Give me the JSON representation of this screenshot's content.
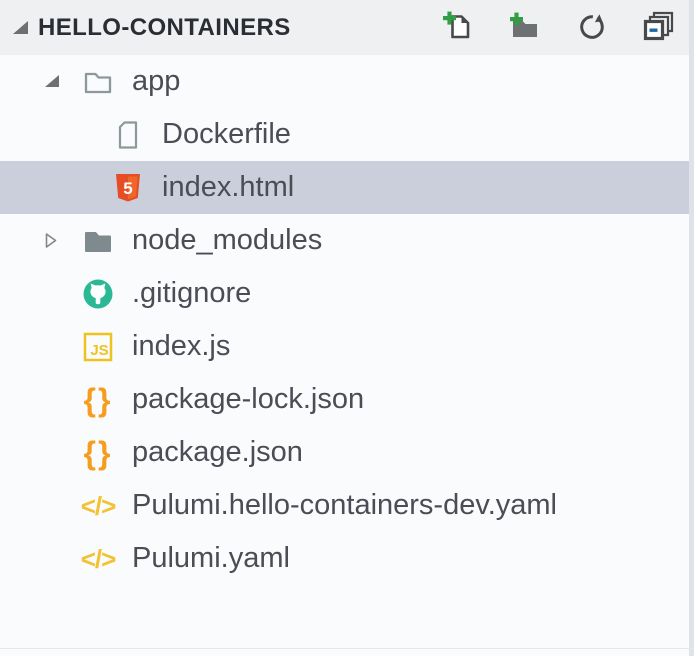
{
  "header": {
    "title": "HELLO-CONTAINERS",
    "expanded": true,
    "actions": [
      {
        "id": "new-file"
      },
      {
        "id": "new-folder"
      },
      {
        "id": "refresh"
      },
      {
        "id": "collapse-all"
      }
    ]
  },
  "tree": {
    "items": [
      {
        "label": "app",
        "icon": "folder-open-icon",
        "depth": 0,
        "twistie": "expanded",
        "selected": false
      },
      {
        "label": "Dockerfile",
        "icon": "file-icon",
        "depth": 1,
        "twistie": "none",
        "selected": false
      },
      {
        "label": "index.html",
        "icon": "html5-icon",
        "depth": 1,
        "twistie": "none",
        "selected": true
      },
      {
        "label": "node_modules",
        "icon": "folder-closed-icon",
        "depth": 0,
        "twistie": "collapsed",
        "selected": false
      },
      {
        "label": ".gitignore",
        "icon": "github-icon",
        "depth": 0,
        "twistie": "none",
        "selected": false
      },
      {
        "label": "index.js",
        "icon": "js-icon",
        "depth": 0,
        "twistie": "none",
        "selected": false
      },
      {
        "label": "package-lock.json",
        "icon": "json-braces-icon",
        "depth": 0,
        "twistie": "none",
        "selected": false
      },
      {
        "label": "package.json",
        "icon": "json-braces-icon",
        "depth": 0,
        "twistie": "none",
        "selected": false
      },
      {
        "label": "Pulumi.hello-containers-dev.yaml",
        "icon": "yaml-code-icon",
        "depth": 0,
        "twistie": "none",
        "selected": false
      },
      {
        "label": "Pulumi.yaml",
        "icon": "yaml-code-icon",
        "depth": 0,
        "twistie": "none",
        "selected": false
      }
    ]
  },
  "colors": {
    "header_bg": "#eef0f2",
    "tree_bg": "#fafbfd",
    "selection_bg": "#cbcedb",
    "text": "#4b4c55",
    "header_text": "#2b2d34",
    "twistie": "#6e6e73",
    "folder_outline": "#8b999b",
    "folder_fill": "#7e8a8d",
    "html5_orange": "#e44d26",
    "github_teal": "#2bb895",
    "js_yellow": "#eec31f",
    "json_orange": "#f59d1e",
    "yaml_gold": "#f2c232",
    "action_icon": "#47494b",
    "plus_green": "#2f9e44",
    "minus_blue": "#2268a8"
  }
}
